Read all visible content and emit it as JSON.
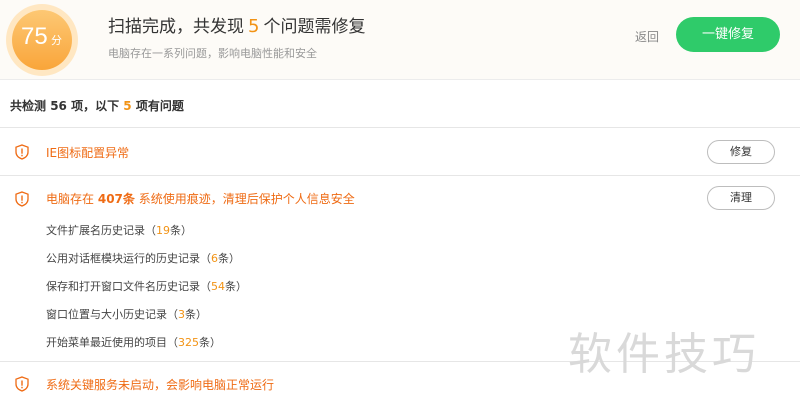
{
  "header": {
    "score": "75",
    "score_unit": "分",
    "title_prefix": "扫描完成，共发现",
    "issue_count": "5",
    "title_suffix": "个问题需修复",
    "subtitle": "电脑存在一系列问题，影响电脑性能和安全",
    "back_label": "返回",
    "fix_all_label": "一键修复"
  },
  "summary": {
    "prefix": "共检测",
    "total": "56",
    "middle": "项，以下",
    "problems": "5",
    "suffix": "项有问题"
  },
  "issues": [
    {
      "title": "IE图标配置异常",
      "action_label": "修复"
    },
    {
      "title_prefix": "电脑存在",
      "count": "407条",
      "title_suffix": "系统使用痕迹，清理后保护个人信息安全",
      "action_label": "清理",
      "items": [
        {
          "label": "文件扩展名历史记录",
          "open": "（",
          "count": "19",
          "unit": "条）"
        },
        {
          "label": "公用对话框模块运行的历史记录",
          "open": "（",
          "count": "6",
          "unit": "条）"
        },
        {
          "label": "保存和打开窗口文件名历史记录",
          "open": "（",
          "count": "54",
          "unit": "条）"
        },
        {
          "label": "窗口位置与大小历史记录",
          "open": "（",
          "count": "3",
          "unit": "条）"
        },
        {
          "label": "开始菜单最近使用的项目",
          "open": "（",
          "count": "325",
          "unit": "条）"
        }
      ]
    },
    {
      "title": "系统关键服务未启动，会影响电脑正常运行"
    }
  ],
  "watermark": "软件技巧",
  "colors": {
    "accent_orange": "#f29315",
    "warning_orange": "#ef6b14",
    "primary_green": "#2fcb6a"
  },
  "icons": {
    "issue_icon": "shield-warning-icon"
  }
}
